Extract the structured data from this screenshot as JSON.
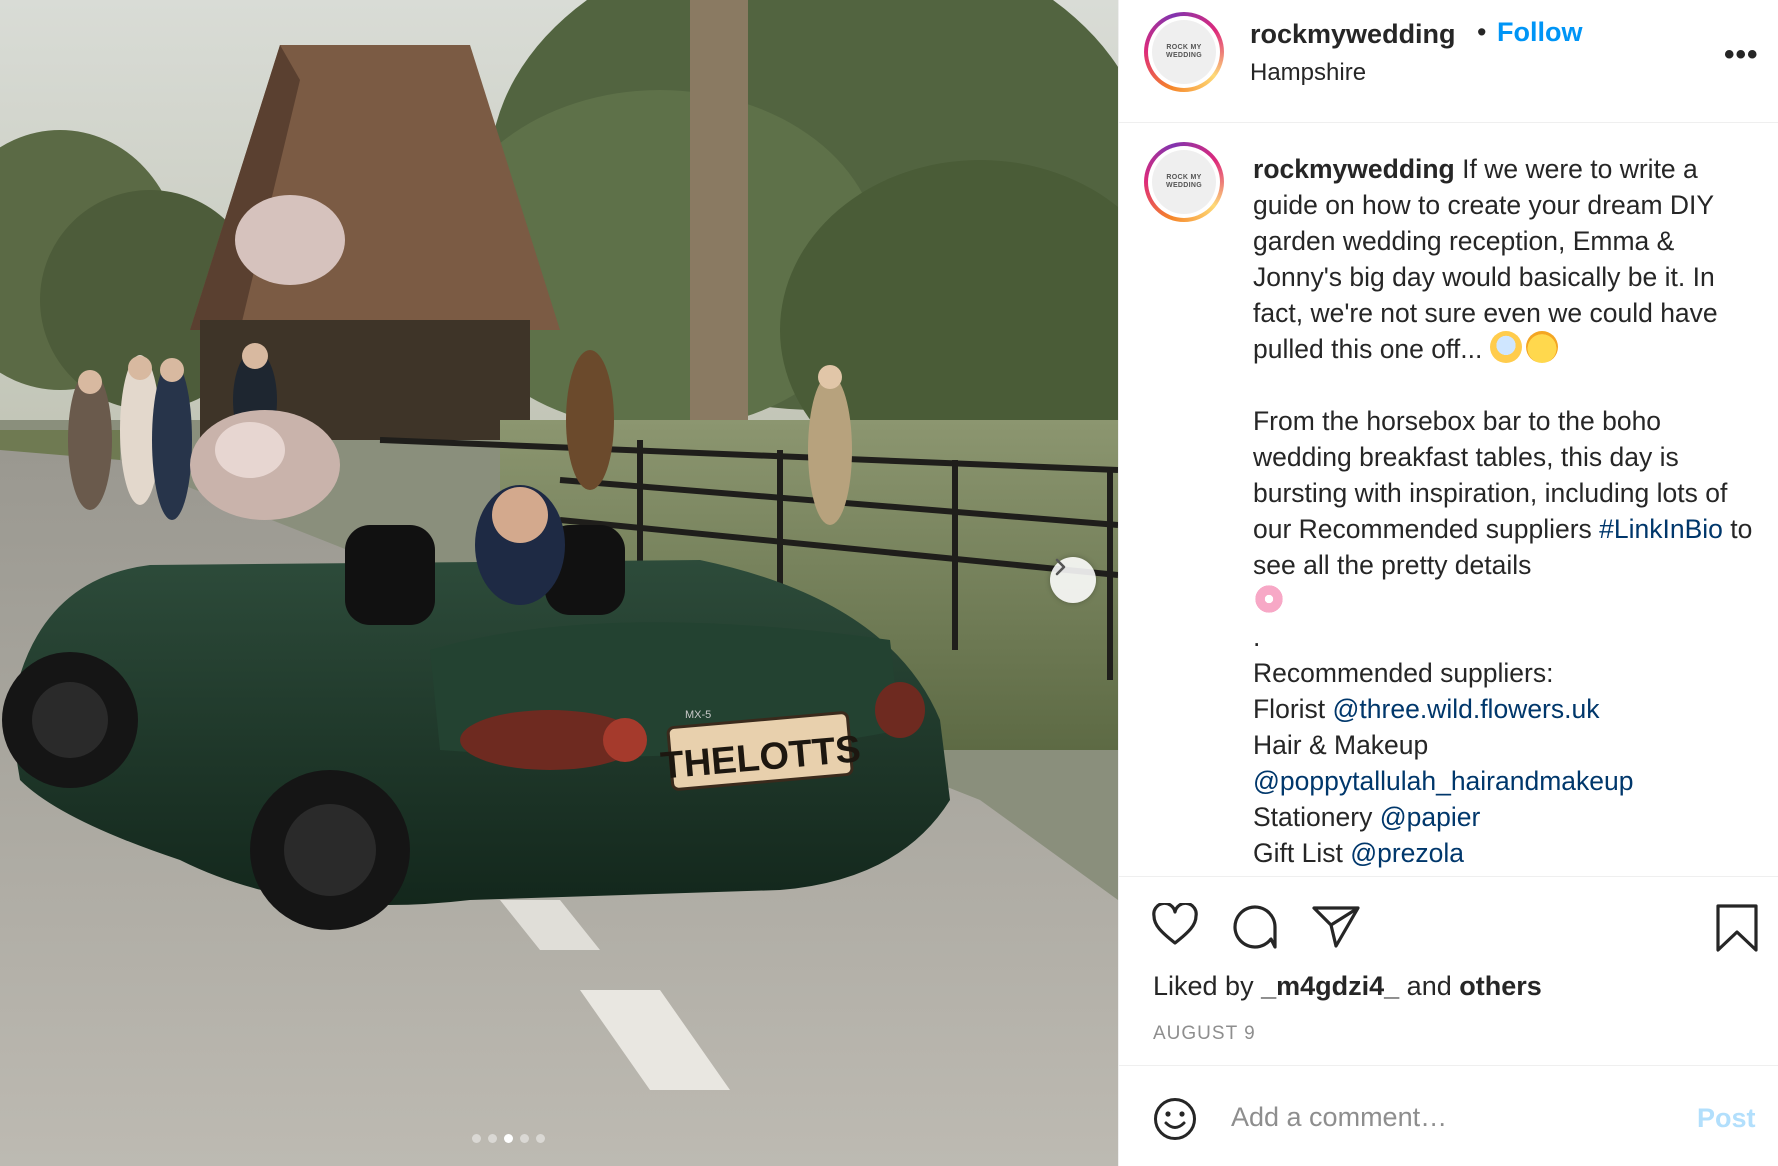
{
  "photo": {
    "plate_text": "THELOTTS",
    "badge_text": "MX-5",
    "carousel": {
      "count": 5,
      "active_index": 2
    },
    "next_icon": "chevron-right-icon"
  },
  "header": {
    "username": "rockmywedding",
    "separator": "•",
    "follow_label": "Follow",
    "location": "Hampshire",
    "more_label": "•••",
    "avatar_line1": "ROCK MY",
    "avatar_line2": "WEDDING"
  },
  "caption": {
    "username": "rockmywedding",
    "para1": "If we were to write a guide on how to create your dream DIY garden wedding reception, Emma & Jonny's big day would basically be it. In fact, we're not sure even we could have pulled this one off...",
    "para2_a": "From the horsebox bar to the boho wedding breakfast tables, this day is bursting with inspiration, including lots of our Recommended suppliers",
    "hashtag": "#LinkInBio",
    "para2_b": "to see all the pretty details",
    "dot_line": ".",
    "suppliers_heading": "Recommended suppliers:",
    "florist_label": "Florist",
    "florist_handle": "@three.wild.flowers.uk",
    "hair_label": "Hair & Makeup",
    "hair_handle": "@poppytallulah_hairandmakeup",
    "stationery_label": "Stationery",
    "stationery_handle": "@papier",
    "gift_label": "Gift List",
    "gift_handle": "@prezola"
  },
  "actions": {
    "liked_prefix": "Liked by",
    "liked_user": "_m4gdzi4_",
    "liked_and": "and",
    "liked_others": "others",
    "date": "AUGUST 9",
    "icons": [
      "heart-icon",
      "comment-icon",
      "share-icon",
      "bookmark-icon"
    ]
  },
  "comment": {
    "placeholder": "Add a comment…",
    "post_label": "Post",
    "emoji_icon": "smiley-icon"
  },
  "colors": {
    "link": "#00376b",
    "follow": "#0095f6",
    "post_disabled": "#b2dffc",
    "muted": "#8e8e8e",
    "car_green": "#1f3a2c"
  }
}
